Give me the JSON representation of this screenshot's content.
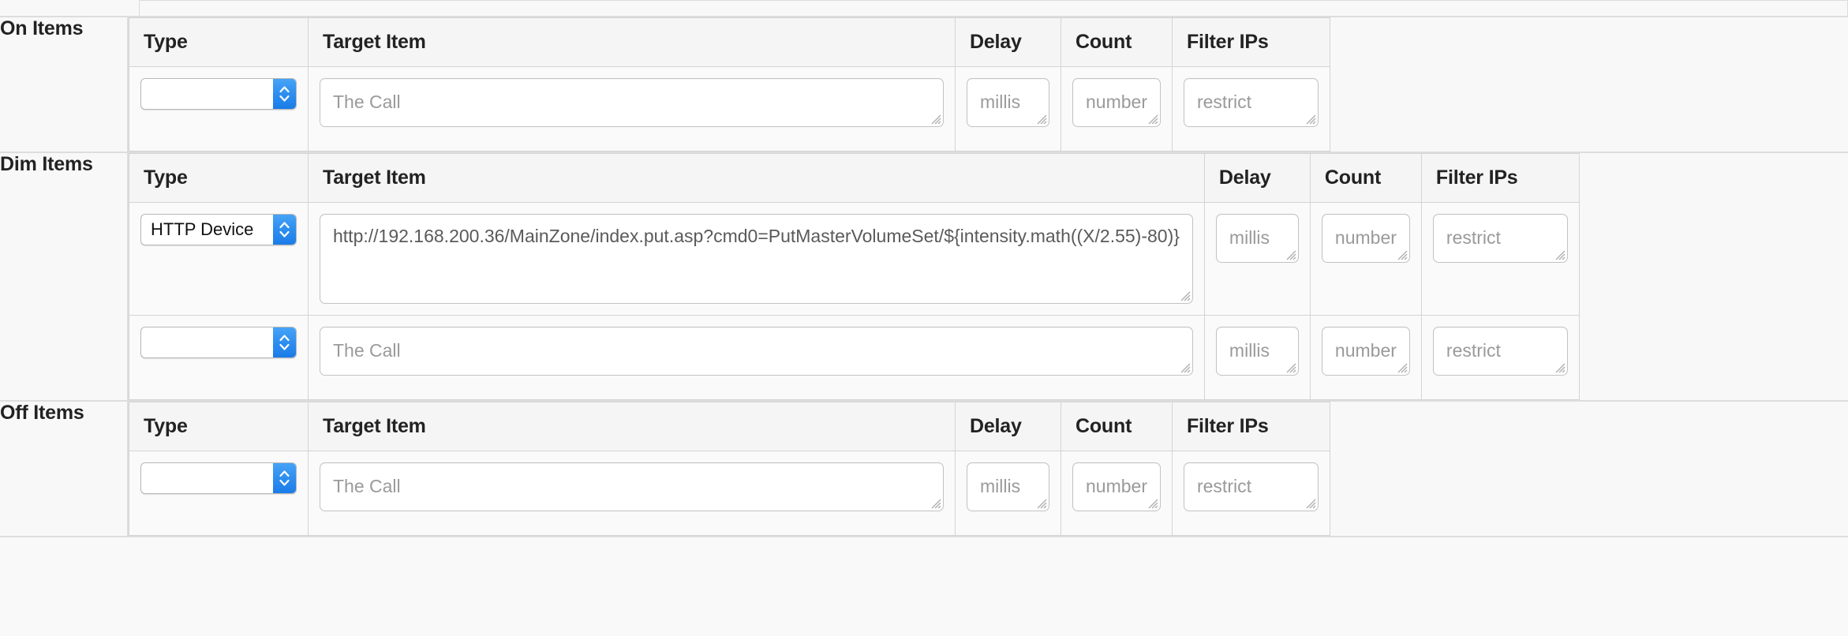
{
  "columns": {
    "type": "Type",
    "target_item": "Target Item",
    "delay": "Delay",
    "count": "Count",
    "filter_ips": "Filter IPs"
  },
  "placeholders": {
    "target_item": "The Call",
    "delay": "millis",
    "count": "number",
    "filter_ips": "restrict"
  },
  "sections": [
    {
      "label": "On Items",
      "rows": [
        {
          "type": "",
          "target_value": "",
          "delay": "",
          "count": "",
          "filter_ips": ""
        }
      ]
    },
    {
      "label": "Dim Items",
      "rows": [
        {
          "type": "HTTP Device",
          "target_value": "http://192.168.200.36/MainZone/index.put.asp?cmd0=PutMasterVolumeSet/${intensity.math((X/2.55)-80)}",
          "delay": "",
          "count": "",
          "filter_ips": ""
        },
        {
          "type": "",
          "target_value": "",
          "delay": "",
          "count": "",
          "filter_ips": ""
        }
      ]
    },
    {
      "label": "Off Items",
      "rows": [
        {
          "type": "",
          "target_value": "",
          "delay": "",
          "count": "",
          "filter_ips": ""
        }
      ]
    }
  ],
  "colors": {
    "stepper_blue": "#2e8ef0",
    "header_bg": "#f5f5f5",
    "border": "#d4d4d4",
    "placeholder_text": "#9a9a9a",
    "label_text": "#222222"
  }
}
